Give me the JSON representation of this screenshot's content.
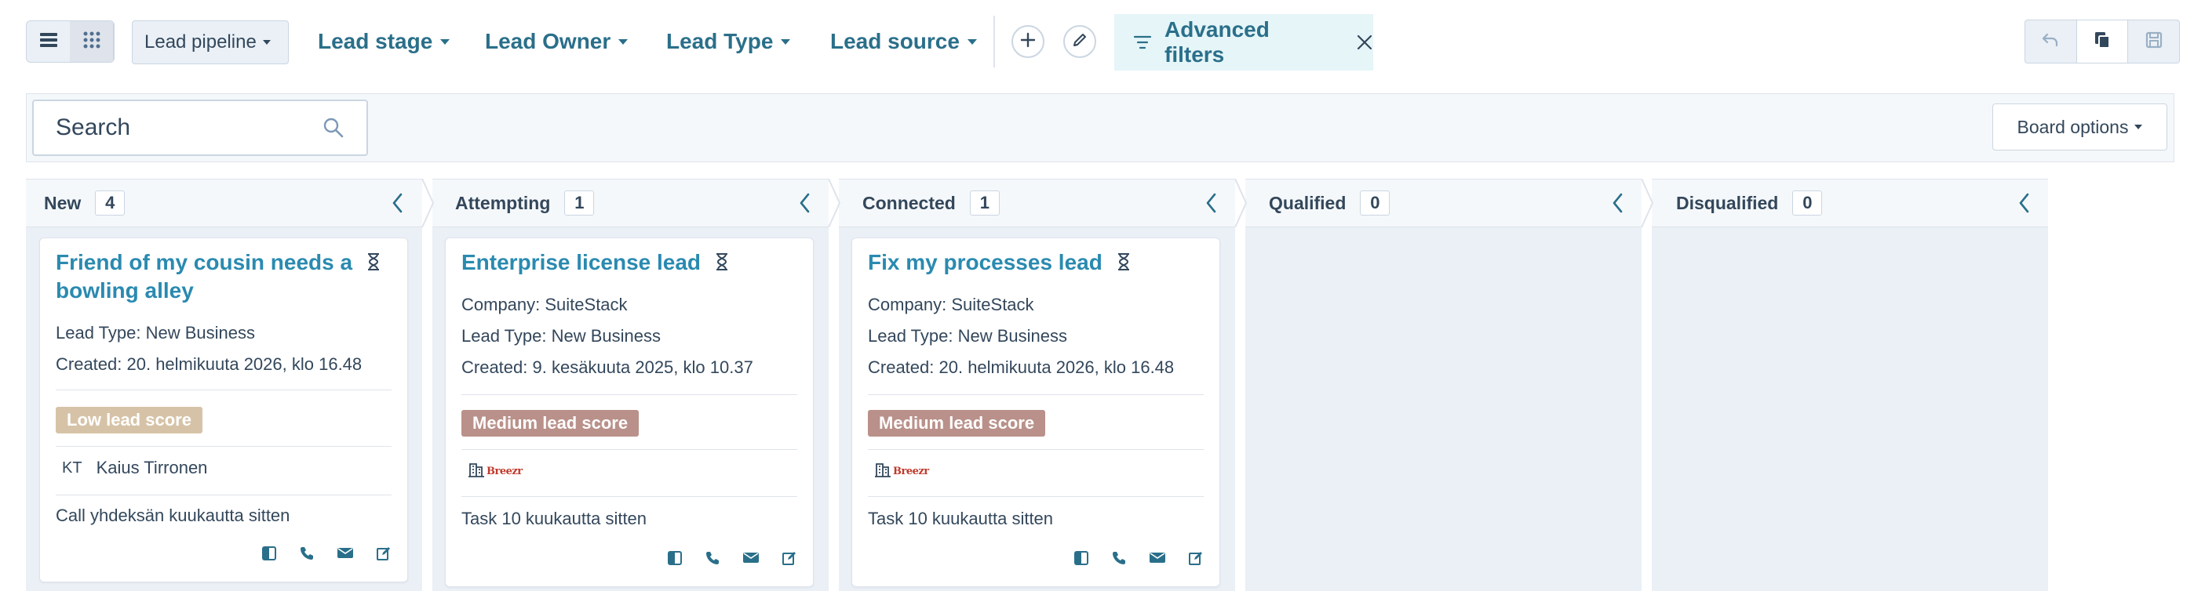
{
  "toolbar": {
    "pipeline_label": "Lead pipeline",
    "filters": [
      {
        "label": "Lead stage"
      },
      {
        "label": "Lead Owner"
      },
      {
        "label": "Lead Type"
      },
      {
        "label": "Lead source"
      }
    ],
    "advanced_filters_label": "Advanced filters"
  },
  "search": {
    "placeholder": "Search"
  },
  "board_options_label": "Board options",
  "columns": [
    {
      "name": "New",
      "count": "4"
    },
    {
      "name": "Attempting",
      "count": "1"
    },
    {
      "name": "Connected",
      "count": "1"
    },
    {
      "name": "Qualified",
      "count": "0"
    },
    {
      "name": "Disqualified",
      "count": "0"
    }
  ],
  "cards": [
    {
      "title_line1": "Friend of my cousin needs a",
      "title_line2": "bowling alley",
      "lead_type": "Lead Type: New Business",
      "created": "Created: 20. helmikuuta 2026, klo 16.48",
      "score": "Low lead score",
      "owner_initials": "KT",
      "owner_name": "Kaius Tirronen",
      "activity": "Call yhdeksän kuukautta sitten"
    },
    {
      "title": "Enterprise license lead",
      "company": "Company: SuiteStack",
      "lead_type": "Lead Type: New Business",
      "created": "Created: 9. kesäkuuta 2025, klo 10.37",
      "score": "Medium lead score",
      "logo_text": "Breezr",
      "activity": "Task 10 kuukautta sitten"
    },
    {
      "title": "Fix my processes lead",
      "company": "Company: SuiteStack",
      "lead_type": "Lead Type: New Business",
      "created": "Created: 20. helmikuuta 2026, klo 16.48",
      "score": "Medium lead score",
      "logo_text": "Breezr",
      "activity": "Task 10 kuukautta sitten"
    }
  ],
  "colors": {
    "accent": "#2a6f8a",
    "link": "#2a8ab0",
    "low_score": "#d6c3a7",
    "medium_score": "#b9918a",
    "column_bg": "#eaf0f6"
  }
}
